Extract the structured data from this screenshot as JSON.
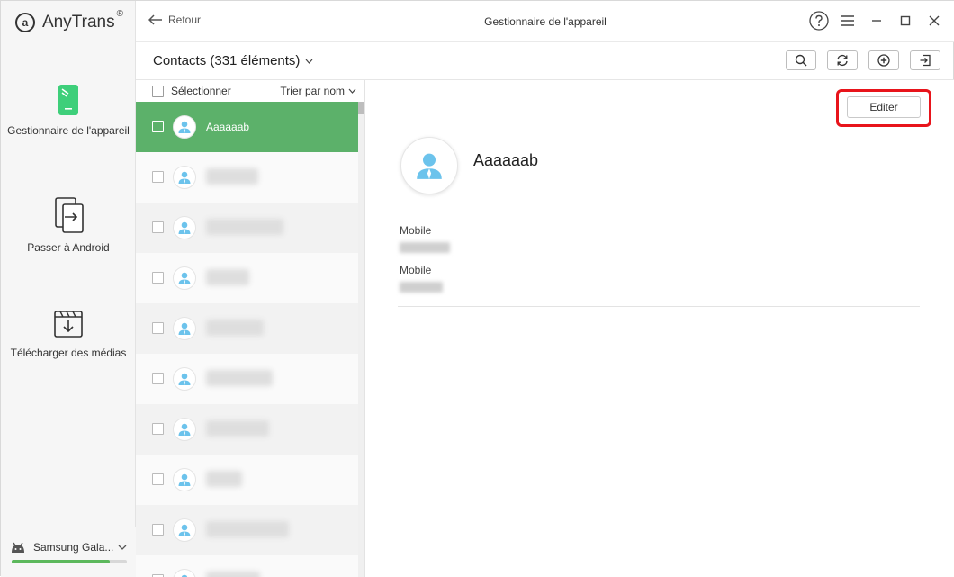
{
  "app": {
    "brand_name": "AnyTrans",
    "brand_reg": "®",
    "brand_logo": "a"
  },
  "sidebar": {
    "items": [
      {
        "label": "Gestionnaire de l'appareil",
        "icon": "phone-icon"
      },
      {
        "label": "Passer à Android",
        "icon": "transfer-icon"
      },
      {
        "label": "Télécharger des médias",
        "icon": "download-media-icon"
      }
    ],
    "device": {
      "name": "Samsung Gala...",
      "storage_used_fraction": 0.85
    }
  },
  "titlebar": {
    "back_label": "Retour",
    "title": "Gestionnaire de l'appareil"
  },
  "toolbar": {
    "section_title": "Contacts (331 éléments)",
    "buttons": [
      "search-icon",
      "refresh-icon",
      "add-icon",
      "export-icon"
    ]
  },
  "list": {
    "select_all_label": "Sélectionner",
    "sort_label": "Trier par nom",
    "selected_contact": "Aaaaaab"
  },
  "detail": {
    "edit_label": "Editer",
    "name": "Aaaaaab",
    "fields": [
      {
        "label": "Mobile"
      },
      {
        "label": "Mobile"
      }
    ]
  },
  "colors": {
    "accent_green": "#5cb16a",
    "highlight_red": "#e8141b",
    "avatar_blue": "#6cc3ec"
  }
}
